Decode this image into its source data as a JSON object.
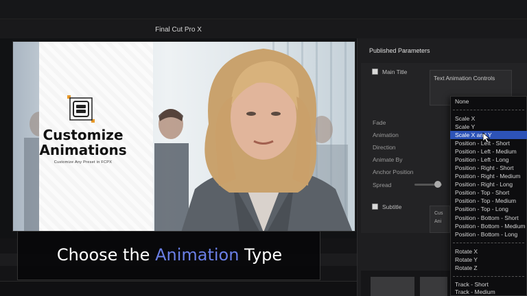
{
  "app": {
    "title": "Final Cut Pro X"
  },
  "viewer": {
    "card_title_line1": "Customize",
    "card_title_line2": "Animations",
    "card_subtitle": "Customize Any Preset in FCPX"
  },
  "caption": {
    "before": "Choose the ",
    "highlight": "Animation",
    "after": " Type",
    "highlight_color": "#6a7fe6"
  },
  "inspector": {
    "header": "Published Parameters",
    "main_title": "Main Title",
    "text_animation_controls": "Text Animation Controls",
    "params": [
      "Fade",
      "Animation",
      "Direction",
      "Animate By",
      "Anchor Position",
      "Spread"
    ],
    "subtitle": "Subtitle",
    "subtitle_box_lines": [
      "Cus",
      "Ani"
    ]
  },
  "dropdown": {
    "selected": "Scale X and Y",
    "selected_color": "#2d53b8",
    "groups": [
      [
        "None"
      ],
      [
        "Scale X",
        "Scale Y",
        "Scale X and Y",
        "Position - Left - Short",
        "Position - Left - Medium",
        "Position - Left - Long",
        "Position - Right - Short",
        "Position - Right - Medium",
        "Position - Right - Long",
        "Position - Top - Short",
        "Position - Top - Medium",
        "Position - Top - Long",
        "Position - Bottom - Short",
        "Position - Bottom - Medium",
        "Position - Bottom - Long"
      ],
      [
        "Rotate X",
        "Rotate Y",
        "Rotate Z"
      ],
      [
        "Track - Short",
        "Track - Medium"
      ]
    ]
  }
}
